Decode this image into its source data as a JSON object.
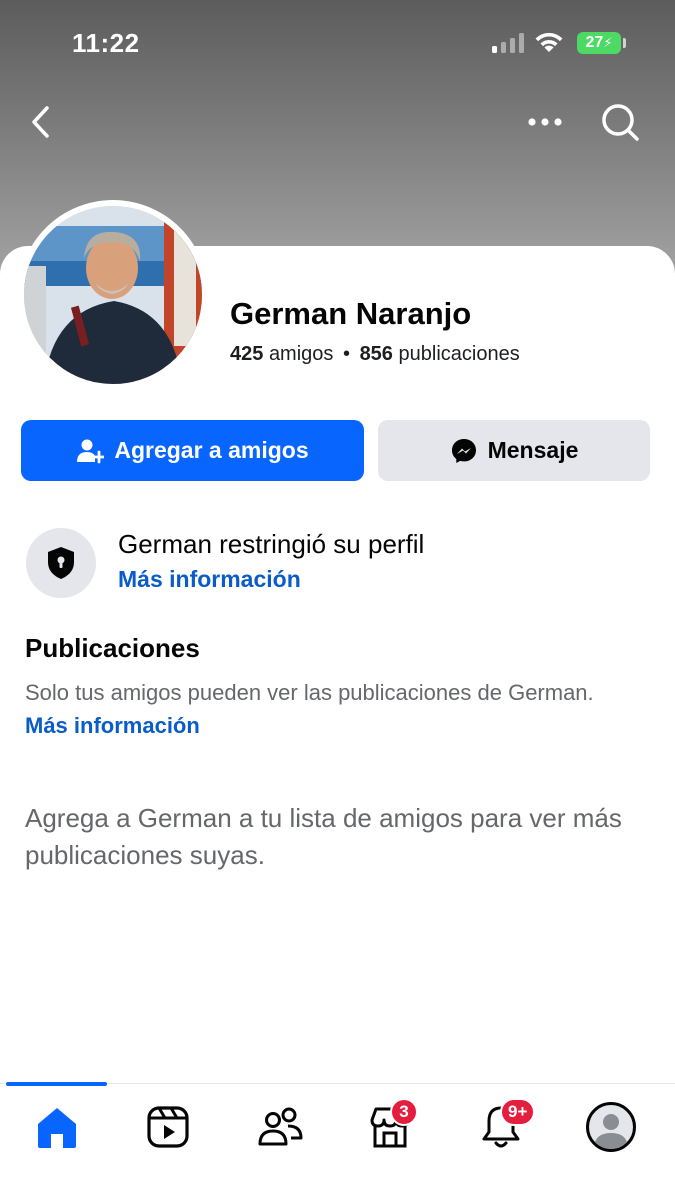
{
  "status_bar": {
    "time": "11:22",
    "battery": "27"
  },
  "profile": {
    "name": "German Naranjo",
    "friends_count": "425",
    "friends_label": "amigos",
    "separator": "•",
    "posts_count": "856",
    "posts_label": "publicaciones"
  },
  "actions": {
    "add_friend_label": "Agregar a amigos",
    "message_label": "Mensaje"
  },
  "restriction": {
    "title": "German restringió su perfil",
    "link": "Más información"
  },
  "posts_section": {
    "heading": "Publicaciones",
    "text": "Solo tus amigos pueden ver las publicaciones de German.",
    "link": "Más información",
    "add_hint": "Agrega a German a tu lista de amigos para ver más publicaciones suyas."
  },
  "tabbar": {
    "marketplace_badge": "3",
    "notifications_badge": "9+"
  },
  "colors": {
    "primary": "#0866ff",
    "link": "#0a5cc9",
    "badge": "#e41e3f",
    "battery": "#4cd964"
  }
}
